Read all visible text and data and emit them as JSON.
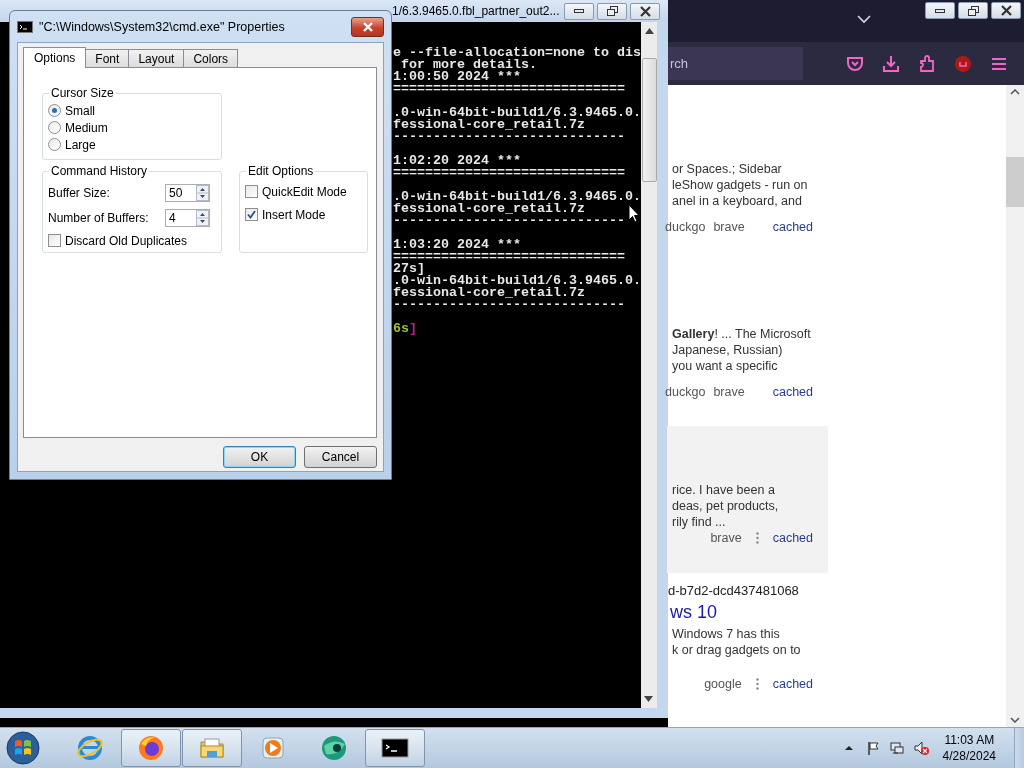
{
  "console": {
    "title": "1/6.3.9465.0.fbl_partner_out2...",
    "lines": [
      {
        "kind": "text",
        "text": "e --file-allocation=none to dis"
      },
      {
        "kind": "text",
        "text": " for more details."
      },
      {
        "kind": "text",
        "text": "1:00:50 2024 ***"
      },
      {
        "kind": "text",
        "text": "============================="
      },
      {
        "kind": "blank"
      },
      {
        "kind": "text",
        "text": ".0-win-64bit-build1/6.3.9465.0."
      },
      {
        "kind": "text",
        "text": "fessional-core_retail.7z"
      },
      {
        "kind": "text",
        "text": "-----------------------------"
      },
      {
        "kind": "blank"
      },
      {
        "kind": "text",
        "text": "1:02:20 2024 ***"
      },
      {
        "kind": "text",
        "text": "============================="
      },
      {
        "kind": "blank"
      },
      {
        "kind": "text",
        "text": ".0-win-64bit-build1/6.3.9465.0."
      },
      {
        "kind": "text",
        "text": "fessional-core_retail.7z"
      },
      {
        "kind": "text",
        "text": "-----------------------------"
      },
      {
        "kind": "blank"
      },
      {
        "kind": "text",
        "text": "1:03:20 2024 ***"
      },
      {
        "kind": "text",
        "text": "============================="
      },
      {
        "kind": "text",
        "text": "27s]"
      },
      {
        "kind": "text",
        "text": ".0-win-64bit-build1/6.3.9465.0."
      },
      {
        "kind": "text",
        "text": "fessional-core_retail.7z"
      },
      {
        "kind": "text",
        "text": "-----------------------------"
      },
      {
        "kind": "blank"
      },
      {
        "kind": "status",
        "segments": [
          {
            "text": "6s",
            "color": "#9cc040"
          },
          {
            "text": "]",
            "color": "#c0208a"
          }
        ]
      }
    ]
  },
  "dialog": {
    "title": "\"C:\\Windows\\System32\\cmd.exe\" Properties",
    "tabs": [
      {
        "label": "Options",
        "selected": true
      },
      {
        "label": "Font",
        "selected": false
      },
      {
        "label": "Layout",
        "selected": false
      },
      {
        "label": "Colors",
        "selected": false
      }
    ],
    "cursor_size": {
      "legend": "Cursor Size",
      "options": [
        {
          "label": "Small",
          "selected": true
        },
        {
          "label": "Medium",
          "selected": false
        },
        {
          "label": "Large",
          "selected": false
        }
      ]
    },
    "command_history": {
      "legend": "Command History",
      "fields": [
        {
          "label": "Buffer Size:",
          "value": "50"
        },
        {
          "label": "Number of Buffers:",
          "value": "4"
        }
      ],
      "checkboxes": [
        {
          "label": "Discard Old Duplicates",
          "checked": false
        }
      ]
    },
    "edit_options": {
      "legend": "Edit Options",
      "checkboxes": [
        {
          "label": "QuickEdit Mode",
          "checked": false
        },
        {
          "label": "Insert Mode",
          "checked": true
        }
      ]
    },
    "buttons": [
      {
        "label": "OK",
        "default": true
      },
      {
        "label": "Cancel",
        "default": false
      }
    ]
  },
  "browser": {
    "search": {
      "value": "rch"
    },
    "results": [
      {
        "highlighted": false,
        "lines": [
          "or Spaces.; Sidebar",
          "leShow gadgets - run on",
          "anel in a keyboard, and"
        ],
        "sources": [
          "duckgo",
          "brave"
        ],
        "link": "cached"
      },
      {
        "highlighted": false,
        "lines": [
          "**Gallery**! ... The Microsoft",
          "Japanese, Russian)",
          "you want a specific"
        ],
        "sources": [
          "duckgo",
          "brave"
        ],
        "link": "cached"
      },
      {
        "highlighted": true,
        "lines": [
          "rice. I have been a",
          "deas, pet products,",
          "rily find ..."
        ],
        "sources": [
          "brave"
        ],
        "link": "cached"
      },
      {
        "highlighted": false,
        "url": "d-b7d2-dcd437481068",
        "title": "ws 10",
        "lines": [
          "Windows 7 has this",
          "k or drag gadgets on to"
        ],
        "sources": [
          "google"
        ],
        "link": "cached"
      }
    ]
  },
  "taskbar": {
    "apps": [
      {
        "kind": "ie",
        "open": false
      },
      {
        "kind": "firefox",
        "open": true
      },
      {
        "kind": "explorer",
        "open": true
      },
      {
        "kind": "media",
        "open": false
      },
      {
        "kind": "green",
        "open": false
      },
      {
        "kind": "cmd",
        "open": true
      }
    ],
    "clock": {
      "time": "11:03 AM",
      "date": "4/28/2024"
    }
  }
}
